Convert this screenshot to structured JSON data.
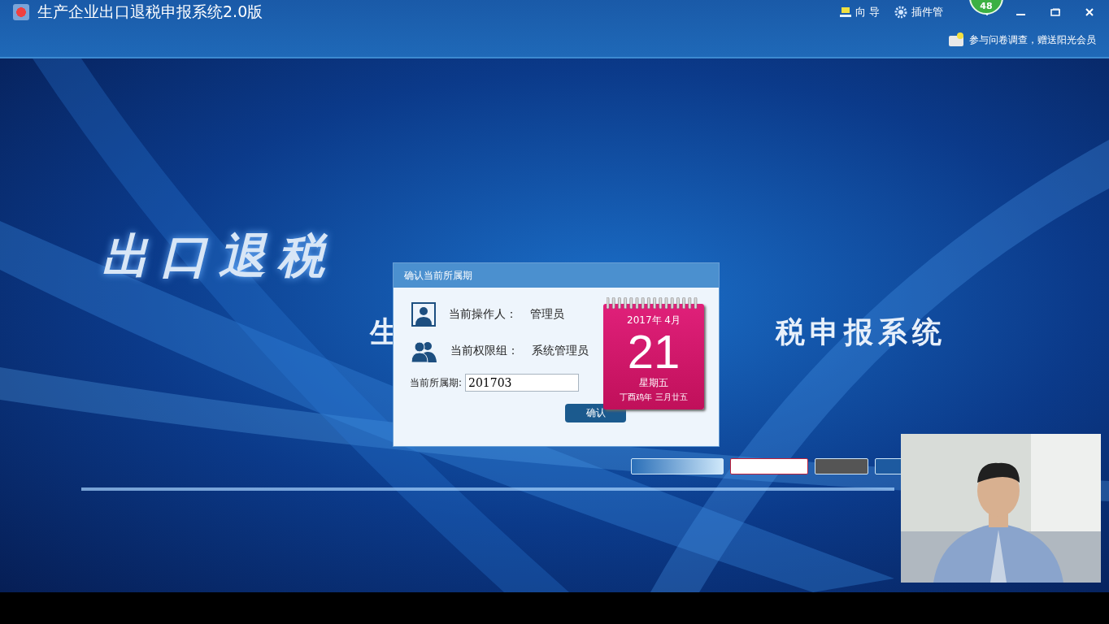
{
  "window": {
    "title": "生产企业出口退税申报系统2.0版"
  },
  "toolbar": {
    "items": [
      {
        "label": "向 导",
        "kind": "guide"
      },
      {
        "label": "插件管",
        "kind": "plugin"
      }
    ],
    "badge": "48"
  },
  "notice": "参与问卷调查，赠送阳光会员",
  "splash": {
    "heading": "出口退税",
    "subtitle_left": "生",
    "subtitle_right": "税申报系统"
  },
  "partner_logos": [
    {
      "kind": "wide"
    },
    {
      "kind": "red"
    },
    {
      "kind": "dark"
    },
    {
      "kind": "small"
    }
  ],
  "dialog": {
    "title": "确认当前所属期",
    "rows": [
      {
        "kind": "user",
        "label": "当前操作人：",
        "value": "管理员"
      },
      {
        "kind": "group",
        "label": "当前权限组：",
        "value": "系统管理员"
      }
    ],
    "period": {
      "label": "当前所属期:",
      "value": "201703"
    },
    "button": "确认",
    "calendar": {
      "year_month": "2017年  4月",
      "day": "21",
      "weekday": "星期五",
      "lunar": "丁酉鸡年  三月廿五"
    }
  }
}
